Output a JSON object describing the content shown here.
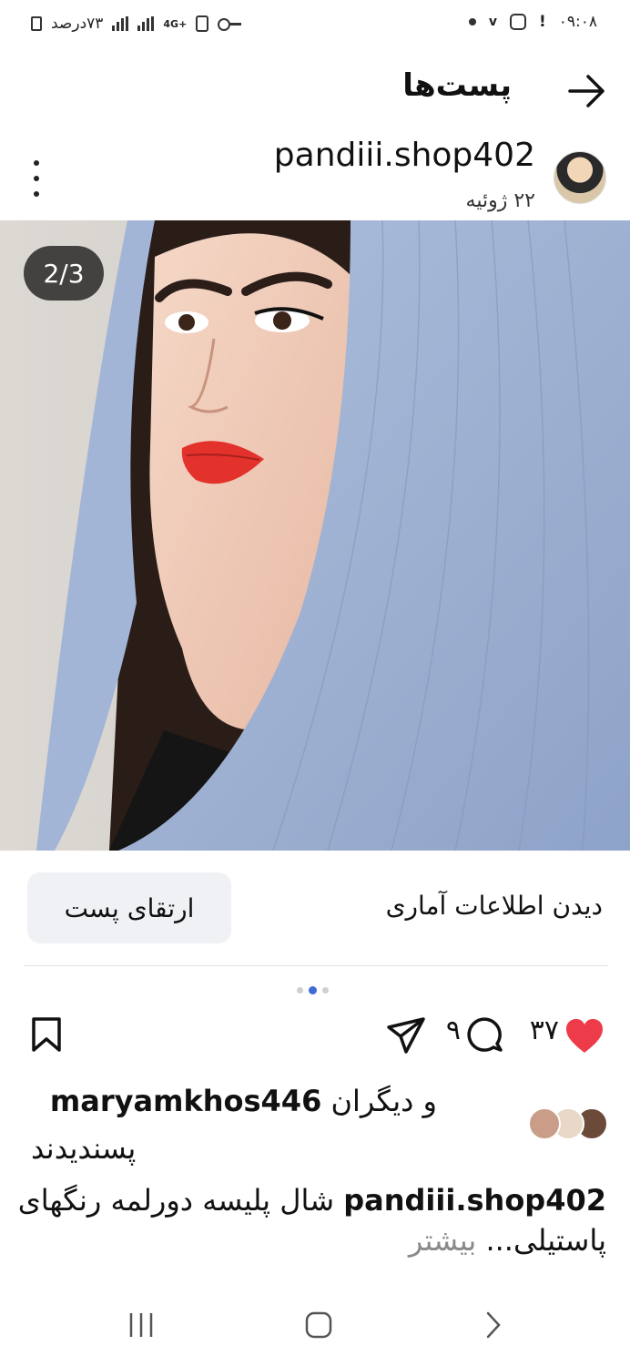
{
  "status_bar": {
    "time": "۰۹:۰۸",
    "battery_text": "۷۳درصد",
    "network": "4G+",
    "notification_icons": [
      "instagram-icon",
      "alert-icon",
      "dot-icon",
      "key-icon",
      "battery-icon",
      "signal-icon"
    ]
  },
  "header": {
    "title": "پست‌ها"
  },
  "post": {
    "username": "pandiii.shop402",
    "date": "۲۲ ژوئیه",
    "image_counter": "2/3",
    "boost_label": "ارتقای پست",
    "insights_label": "دیدن اطلاعات آماری",
    "carousel": {
      "total": 3,
      "active": 2
    },
    "likes_count": "۳۷",
    "comments_count": "۹",
    "likes_line": {
      "prefix": "و دیگران",
      "user": "maryamkhos446",
      "suffix": "پسندیدند"
    },
    "caption": {
      "user": "pandiii.shop402",
      "text": "شال پلیسه دورلمه رنگهای پاستیلی...",
      "more": "بیشتر"
    }
  },
  "colors": {
    "heart": "#ed3b4a",
    "carousel_active": "#3f6bd6",
    "boost_bg": "#eff1f5",
    "scarf": "#9fb3d4"
  }
}
